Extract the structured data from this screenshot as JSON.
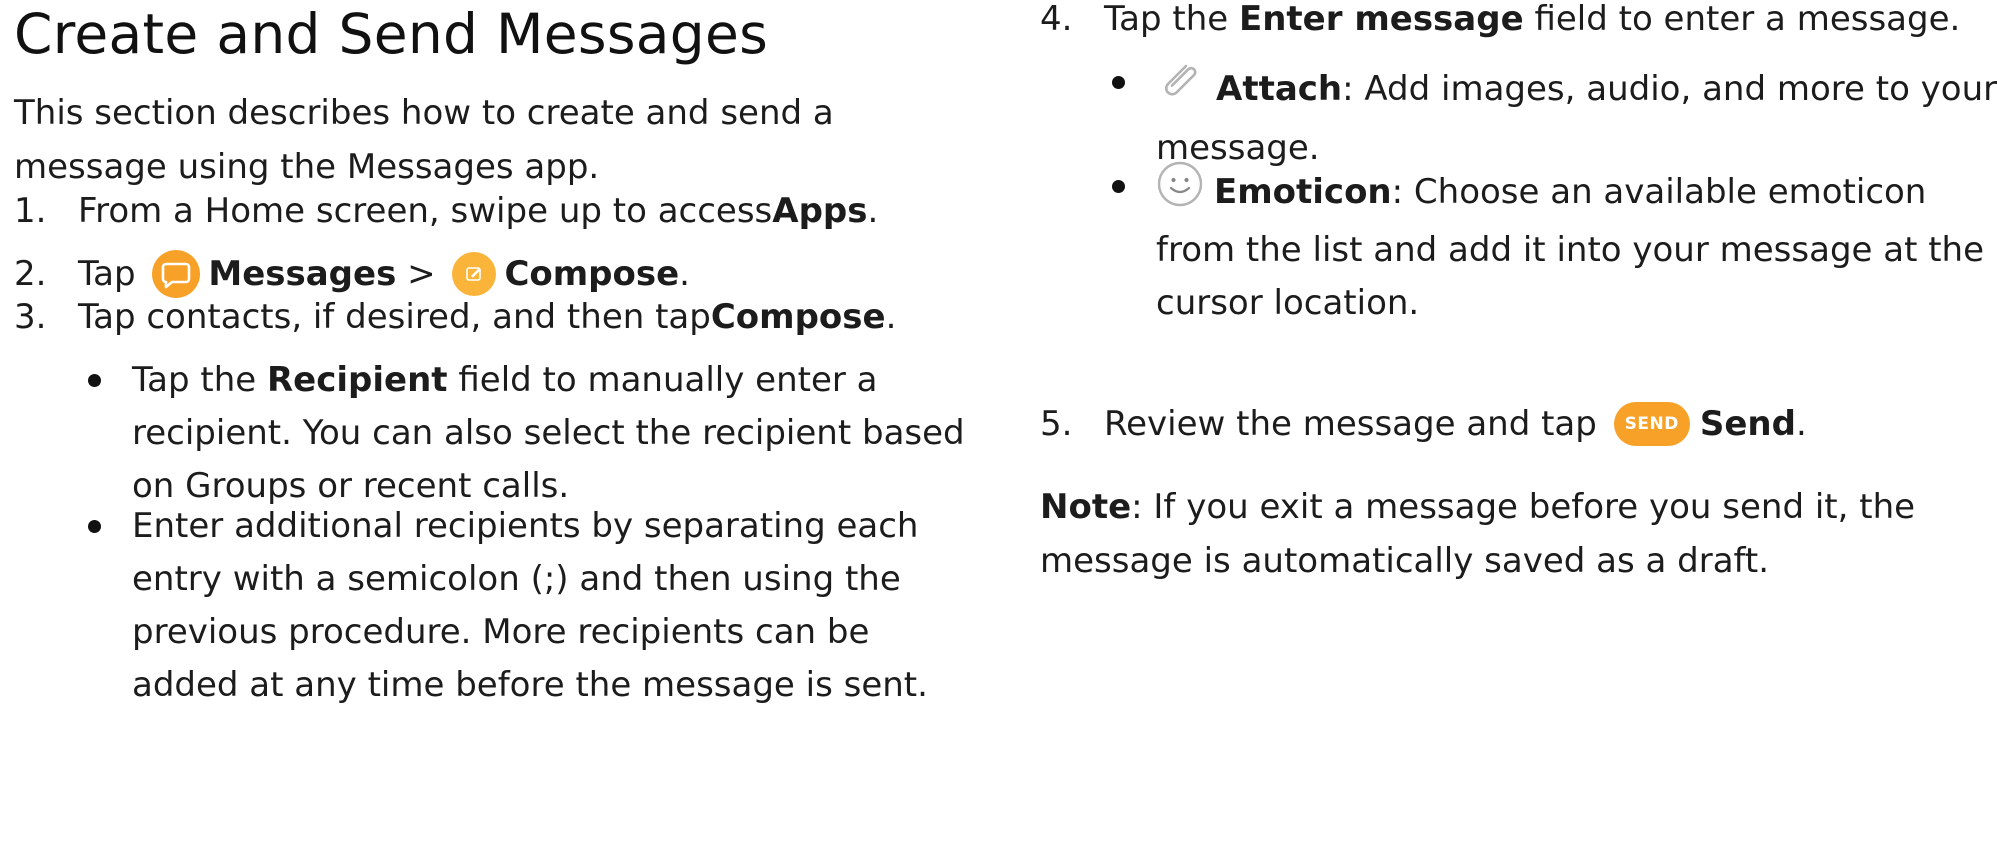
{
  "title": "Create and Send Messages",
  "intro": {
    "line1": "This section describes how to create and send a",
    "line2": "message using the Messages app."
  },
  "steps": {
    "s1": {
      "num": "1.",
      "text": "From a Home screen, swipe up to access ",
      "bold": "Apps",
      "end": "."
    },
    "s2": {
      "num": "2.",
      "pre": "Tap ",
      "messages": "Messages",
      "sep": " > ",
      "compose": "Compose",
      "end": "."
    },
    "s3": {
      "num": "3.",
      "text": "Tap contacts, if desired, and then tap ",
      "bold": "Compose",
      "end": "."
    },
    "s4": {
      "num": "4.",
      "pre": "Tap the ",
      "bold": "Enter message",
      "post": " field to enter a message."
    },
    "s5": {
      "num": "5.",
      "pre": "Review the message and tap ",
      "pill": "SEND",
      "bold": "Send",
      "end": "."
    }
  },
  "bullets3": {
    "b1": {
      "pre": "Tap the ",
      "bold": "Recipient",
      "l1": " field to manually enter a",
      "l2": "recipient. You can also select the recipient based",
      "l3": "on Groups or recent calls."
    },
    "b2": {
      "l1": "Enter additional recipients by separating each",
      "l2": "entry with a semicolon (;) and then using the",
      "l3": "previous procedure. More recipients can be",
      "l4": "added at any time before the message is sent."
    }
  },
  "bullets4": {
    "attach": {
      "bold": "Attach",
      "l1": ": Add images, audio, and more to your",
      "l2": "message."
    },
    "emoticon": {
      "bold": "Emoticon",
      "l1": ": Choose an available emoticon",
      "l2": "from the list and add it into your message at the",
      "l3": "cursor location."
    }
  },
  "note": {
    "bold": "Note",
    "l1": ": If you exit a message before you send it, the",
    "l2": "message is automatically saved as a draft."
  },
  "icons": {
    "messages": "messages-app-icon",
    "compose": "compose-icon",
    "attach": "paperclip-icon",
    "emoticon": "smiley-icon",
    "send": "send-button-icon"
  },
  "colors": {
    "accent": "#f7a128",
    "text": "#1c1c1c"
  }
}
